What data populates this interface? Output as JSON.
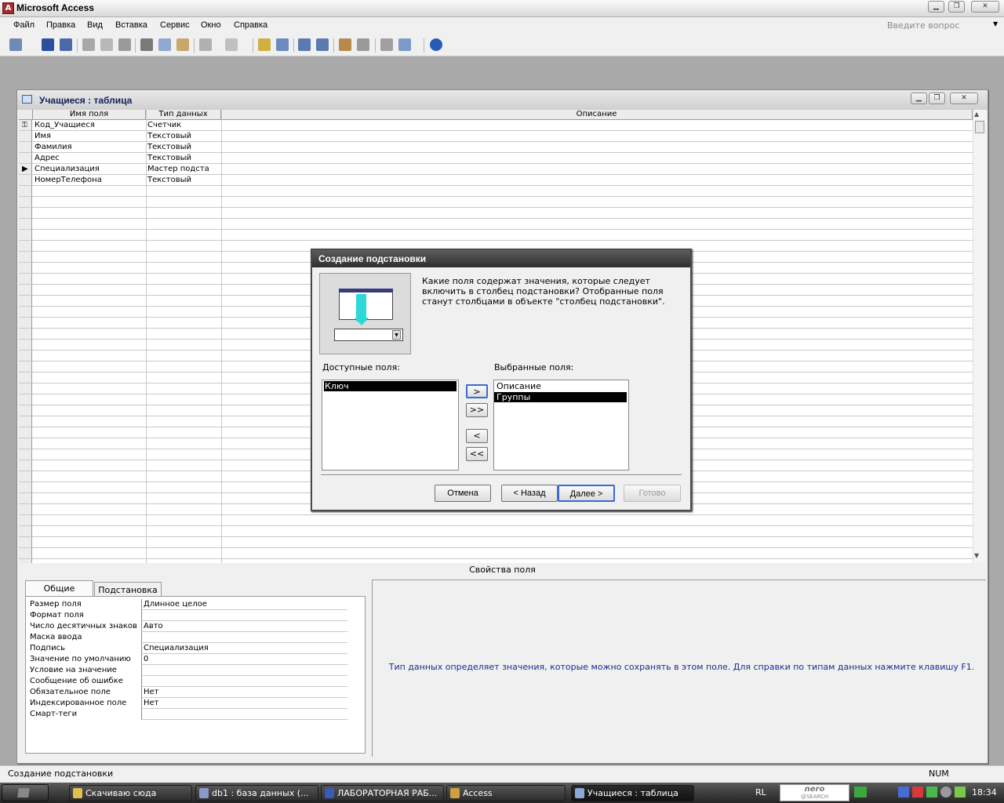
{
  "app": {
    "title": "Microsoft Access",
    "icon": "access-icon"
  },
  "menu": {
    "items": [
      "Файл",
      "Правка",
      "Вид",
      "Вставка",
      "Сервис",
      "Окно",
      "Справка"
    ],
    "help_placeholder": "Введите вопрос"
  },
  "table_window": {
    "title": "Учащиеся : таблица",
    "columns": [
      "Имя поля",
      "Тип данных",
      "Описание"
    ],
    "rows": [
      {
        "name": "Код_Учащиеся",
        "type": "Счетчик",
        "marker": "key"
      },
      {
        "name": "Имя",
        "type": "Текстовый",
        "marker": ""
      },
      {
        "name": "Фамилия",
        "type": "Текстовый",
        "marker": ""
      },
      {
        "name": "Адрес",
        "type": "Текстовый",
        "marker": ""
      },
      {
        "name": "Специализация",
        "type": "Мастер подста",
        "marker": "current"
      },
      {
        "name": "НомерТелефона",
        "type": "Текстовый",
        "marker": ""
      }
    ],
    "props_header": "Свойства поля",
    "tabs": [
      "Общие",
      "Подстановка"
    ],
    "active_tab": "Общие",
    "properties": [
      {
        "label": "Размер поля",
        "value": "Длинное целое"
      },
      {
        "label": "Формат поля",
        "value": ""
      },
      {
        "label": "Число десятичных знаков",
        "value": "Авто"
      },
      {
        "label": "Маска ввода",
        "value": ""
      },
      {
        "label": "Подпись",
        "value": "Специализация"
      },
      {
        "label": "Значение по умолчанию",
        "value": "0"
      },
      {
        "label": "Условие на значение",
        "value": ""
      },
      {
        "label": "Сообщение об ошибке",
        "value": ""
      },
      {
        "label": "Обязательное поле",
        "value": "Нет"
      },
      {
        "label": "Индексированное поле",
        "value": "Нет"
      },
      {
        "label": "Смарт-теги",
        "value": ""
      }
    ],
    "help_text": "Тип данных определяет значения, которые можно сохранять в этом поле.  Для справки по типам данных нажмите клавишу F1."
  },
  "dialog": {
    "title": "Создание подстановки",
    "description": "Какие поля содержат значения, которые следует включить в столбец подстановки? Отобранные поля станут столбцами в объекте \"столбец подстановки\".",
    "available_label": "Доступные поля:",
    "available": [
      "Ключ"
    ],
    "selected_label": "Выбранные поля:",
    "selected": [
      "Описание",
      "Группы"
    ],
    "move_buttons": [
      ">",
      ">>",
      "<",
      "<<"
    ],
    "cancel": "Отмена",
    "back": "< Назад",
    "next": "Далее >",
    "finish": "Готово"
  },
  "status": {
    "text": "Создание подстановки",
    "num": "NUM"
  },
  "taskbar": {
    "tasks": [
      "Скачиваю сюда",
      "db1 : база данных (...",
      "ЛАБОРАТОРНАЯ РАБ...",
      "Access",
      "Учащиеся : таблица"
    ],
    "lang": "RL",
    "search_brand": "nero",
    "search_sub": "@SEARCH",
    "clock": "18:34"
  }
}
